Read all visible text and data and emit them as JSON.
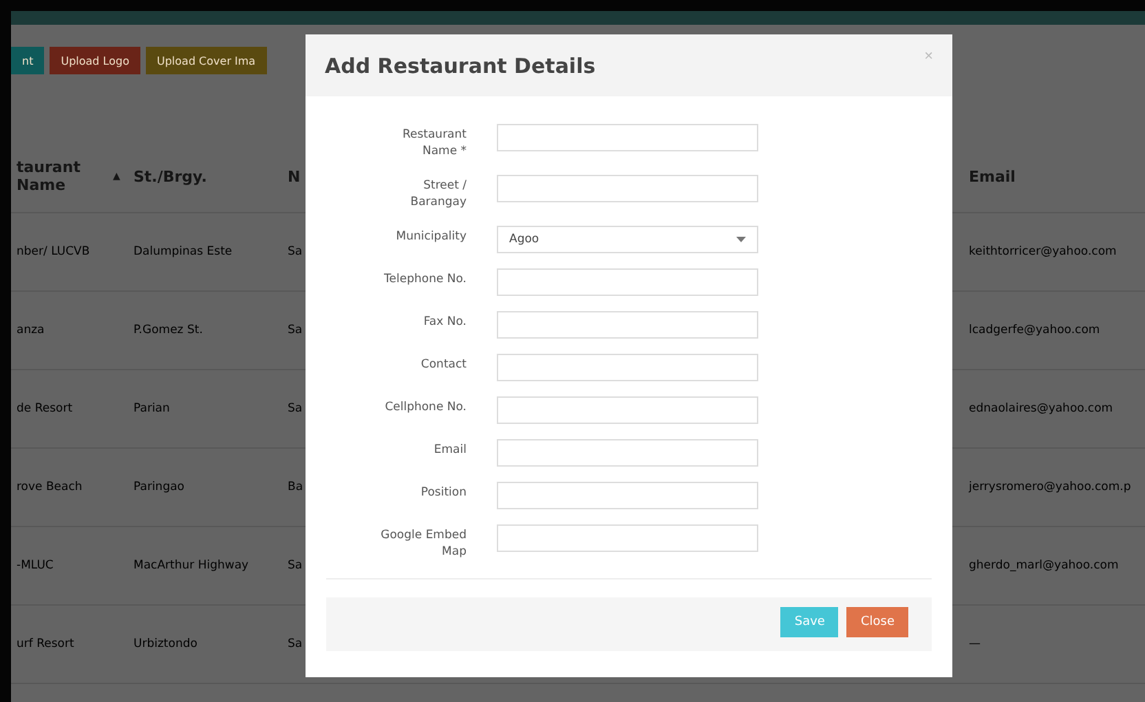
{
  "toolbar": [
    {
      "label": "nt",
      "color": "#0f5a5a"
    },
    {
      "label": "Upload Logo",
      "color": "#6a2418"
    },
    {
      "label": "Upload Cover Ima",
      "color": "#5a4a10"
    }
  ],
  "table": {
    "columns": [
      {
        "label": "taurant Name",
        "sort": "▲"
      },
      {
        "label": "St./Brgy."
      },
      {
        "label": "N"
      },
      {
        "label": "Email"
      }
    ],
    "rows": [
      {
        "cells": [
          "nber/ LUCVB",
          "Dalumpinas Este",
          "Sa",
          "keithtorricer@yahoo.com"
        ]
      },
      {
        "cells": [
          "anza",
          "P.Gomez St.",
          "Sa",
          "lcadgerfe@yahoo.com"
        ]
      },
      {
        "cells": [
          "de Resort",
          "Parian",
          "Sa",
          "ednaolaires@yahoo.com"
        ]
      },
      {
        "cells": [
          "rove Beach",
          "Paringao",
          "Ba",
          "jerrysromero@yahoo.com.p"
        ]
      },
      {
        "cells": [
          "-MLUC",
          "MacArthur Highway",
          "Sa",
          "gherdo_marl@yahoo.com"
        ]
      },
      {
        "cells": [
          "urf Resort",
          "Urbiztondo",
          "Sa",
          "—"
        ]
      }
    ]
  },
  "modal": {
    "title": "Add Restaurant Details",
    "close": "×",
    "fields": [
      {
        "label": "Restaurant Name *",
        "kind": "text"
      },
      {
        "label": "Street / Barangay",
        "kind": "text"
      },
      {
        "label": "Municipality",
        "kind": "select",
        "value": "Agoo"
      },
      {
        "label": "Telephone No.",
        "kind": "text"
      },
      {
        "label": "Fax No.",
        "kind": "text"
      },
      {
        "label": "Contact",
        "kind": "text"
      },
      {
        "label": "Cellphone No.",
        "kind": "text"
      },
      {
        "label": "Email",
        "kind": "text"
      },
      {
        "label": "Position",
        "kind": "text"
      },
      {
        "label": "Google Embed Map",
        "kind": "text"
      }
    ],
    "buttons": [
      {
        "label": "Save",
        "kind": "primary"
      },
      {
        "label": "Close",
        "kind": "danger"
      }
    ]
  }
}
